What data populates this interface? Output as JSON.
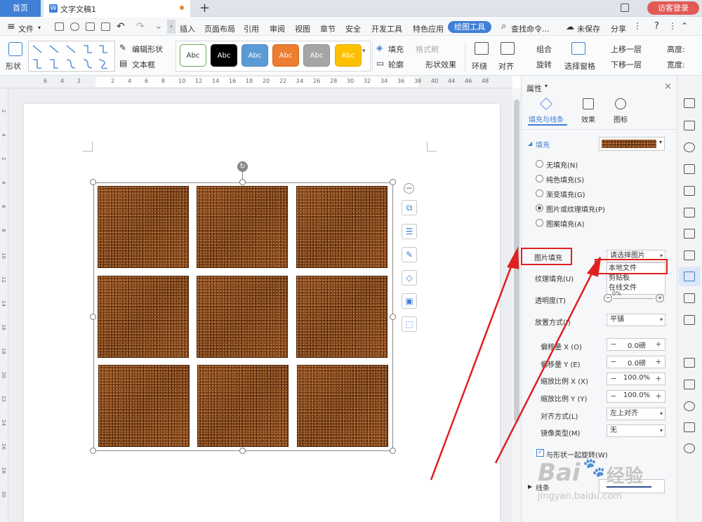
{
  "titlebar": {
    "home_tab": "首页",
    "doc_icon": "W",
    "doc_name": "文字文稿1",
    "new_tab": "+",
    "login": "访客登录"
  },
  "menubar": {
    "file": "文件",
    "items": [
      "插入",
      "页面布局",
      "引用",
      "审阅",
      "视图",
      "章节",
      "安全",
      "开发工具",
      "特色应用"
    ],
    "active_tab": "绘图工具",
    "search": "查找命令...",
    "unsaved": "未保存",
    "share": "分享"
  },
  "ribbon": {
    "shape": "形状",
    "edit_shape": "编辑形状",
    "text_box": "文本框",
    "styles": [
      {
        "label": "Abc",
        "bg": "#ffffff",
        "fg": "#333333",
        "border": "#6aa84f"
      },
      {
        "label": "Abc",
        "bg": "#000000",
        "fg": "#ffffff",
        "border": "#000000"
      },
      {
        "label": "Abc",
        "bg": "#5b9bd5",
        "fg": "#ffffff",
        "border": "#4a86bf"
      },
      {
        "label": "Abc",
        "bg": "#ed7d31",
        "fg": "#ffffff",
        "border": "#d56a22"
      },
      {
        "label": "Abc",
        "bg": "#a5a5a5",
        "fg": "#ffffff",
        "border": "#8f8f8f"
      },
      {
        "label": "Abc",
        "bg": "#ffc000",
        "fg": "#ffffff",
        "border": "#e0a800"
      }
    ],
    "fill": "填充",
    "format_brush": "格式刷",
    "outline": "轮廓",
    "shape_effect": "形状效果",
    "wrap": "环绕",
    "align": "对齐",
    "group": "组合",
    "rotate": "旋转",
    "select_pane": "选择窗格",
    "bring_forward": "上移一层",
    "send_backward": "下移一层",
    "height": "高度:",
    "width": "宽度:"
  },
  "ruler_numbers": [
    "6",
    "4",
    "2",
    "2",
    "4",
    "6",
    "8",
    "10",
    "12",
    "14",
    "16",
    "18",
    "20",
    "22",
    "24",
    "26",
    "28",
    "30",
    "32",
    "34",
    "36",
    "38",
    "40",
    "44",
    "46",
    "48"
  ],
  "vruler_numbers": [
    "2",
    "4",
    "2",
    "4",
    "6",
    "8",
    "10",
    "12",
    "14",
    "16",
    "18",
    "20",
    "22",
    "24",
    "26",
    "28",
    "30"
  ],
  "panel": {
    "title": "属性",
    "tabs": [
      "填充与线条",
      "效果",
      "图标"
    ],
    "fill_section": "填充",
    "radio_options": [
      {
        "label": "无填充(N)",
        "checked": false
      },
      {
        "label": "纯色填充(S)",
        "checked": false
      },
      {
        "label": "渐变填充(G)",
        "checked": false
      },
      {
        "label": "图片或纹理填充(P)",
        "checked": true
      },
      {
        "label": "图案填充(A)",
        "checked": false
      }
    ],
    "picture_fill_label": "图片填充",
    "picture_fill_value": "请选择图片",
    "dropdown_options": [
      "本地文件",
      "剪贴板",
      "在线文件"
    ],
    "texture_fill_label": "纹理填充(U)",
    "transparency_label": "透明度(T)",
    "transparency_value": "0%",
    "placement_label": "放置方式(I)",
    "placement_value": "平铺",
    "offset_x_label": "偏移量 X (O)",
    "offset_x_value": "0.0磅",
    "offset_y_label": "偏移量 Y (E)",
    "offset_y_value": "0.0磅",
    "scale_x_label": "缩放比例 X (X)",
    "scale_x_value": "100.0%",
    "scale_y_label": "缩放比例 Y (Y)",
    "scale_y_value": "100.0%",
    "align_label": "对齐方式(L)",
    "align_value": "左上对齐",
    "mirror_label": "镜像类型(M)",
    "mirror_value": "无",
    "rotate_with_shape": "与形状一起旋转(W)",
    "line_section": "线条"
  },
  "watermark": {
    "brand": "Bai",
    "brand2": "经验",
    "url": "jingyan.baidu.com"
  },
  "colors": {
    "accent": "#3f7fd6",
    "highlight": "#e02020",
    "leather": "#7b4219"
  }
}
